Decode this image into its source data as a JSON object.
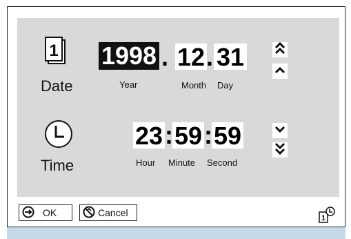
{
  "date": {
    "label": "Date",
    "year": "1998",
    "month": "12",
    "day": "31",
    "separator": ".",
    "year_label": "Year",
    "month_label": "Month",
    "day_label": "Day",
    "selected_field": "year",
    "icon": "calendar-icon",
    "icon_digit": "1"
  },
  "time": {
    "label": "Time",
    "hour": "23",
    "minute": "59",
    "second": "59",
    "separator": ":",
    "hour_label": "Hour",
    "minute_label": "Minute",
    "second_label": "Second",
    "icon": "clock-icon"
  },
  "controls": {
    "fast_up": "double-chevron-up-icon",
    "up": "chevron-up-icon",
    "down": "chevron-down-icon",
    "fast_down": "double-chevron-down-icon"
  },
  "footer": {
    "ok_label": "OK",
    "cancel_label": "Cancel",
    "mode_icon": "calendar-clock-icon"
  },
  "colors": {
    "panel": "#d9d9d9",
    "selected_bg": "#111111",
    "strip": "#c5d9e8"
  }
}
